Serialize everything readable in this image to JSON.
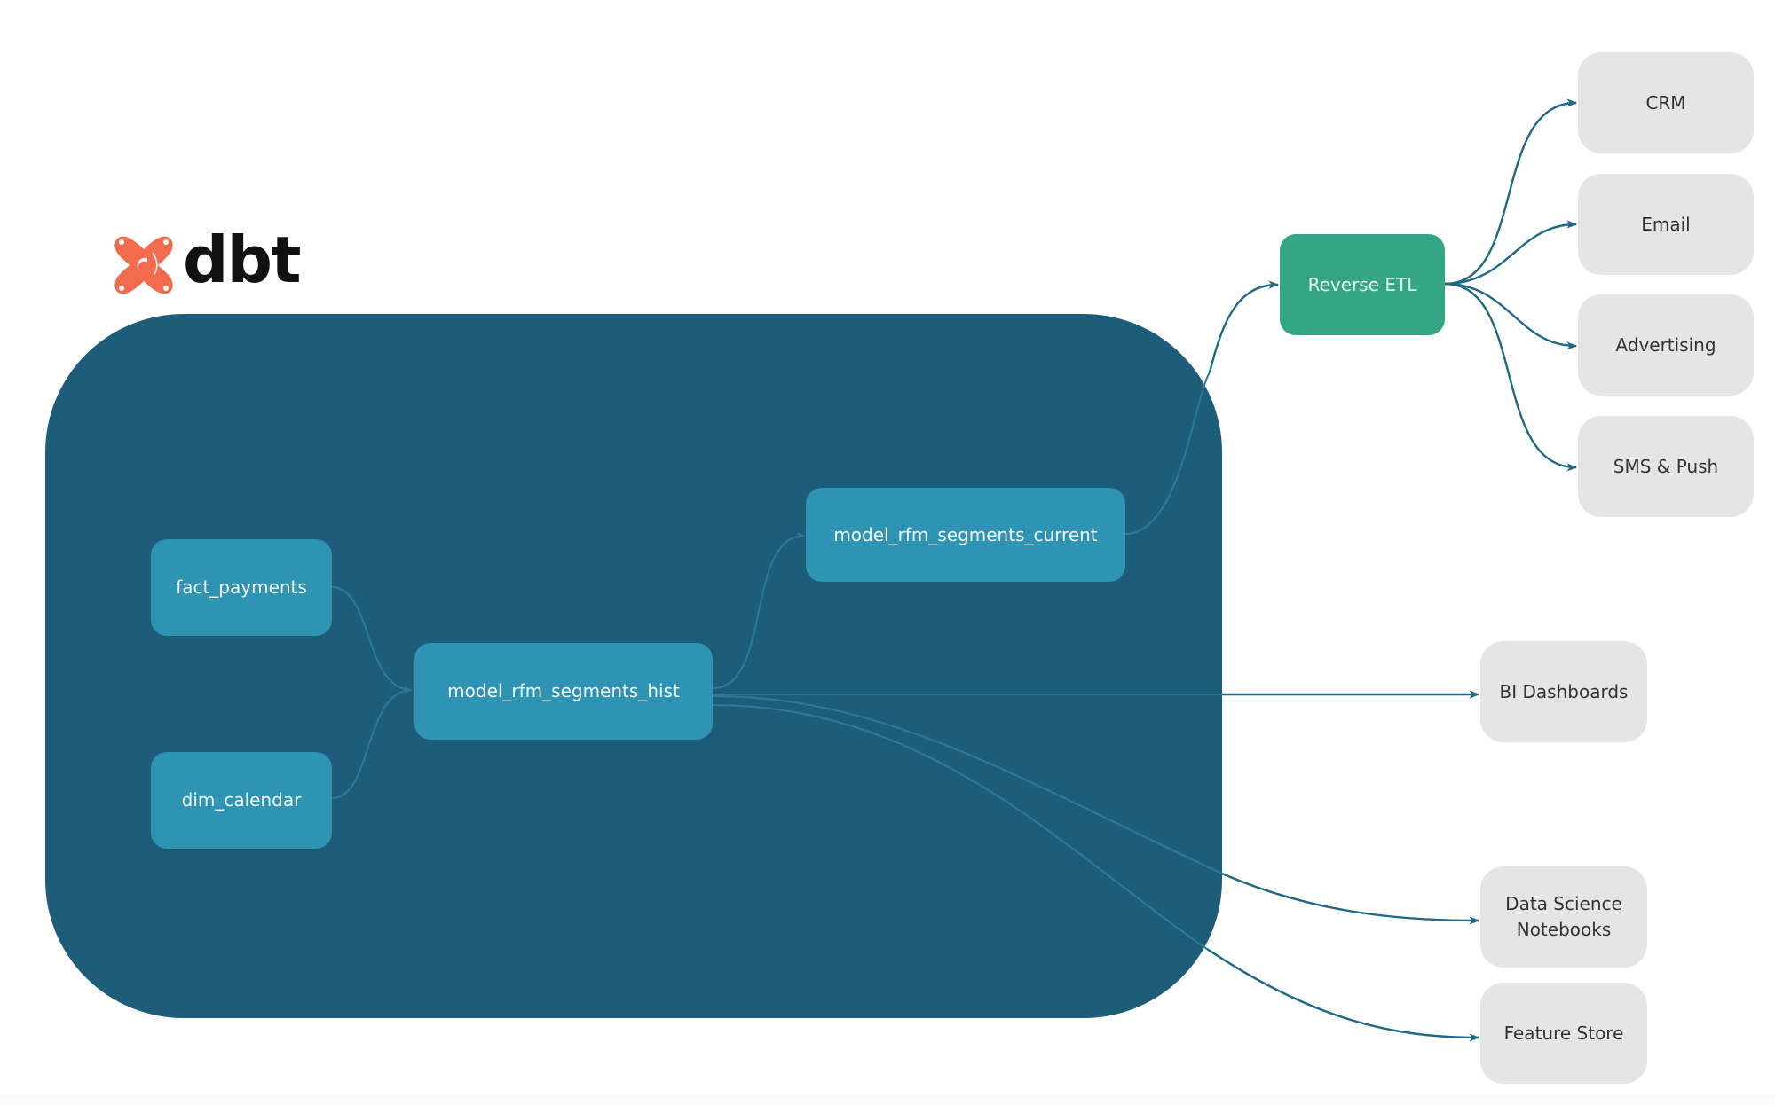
{
  "brand": {
    "name": "dbt",
    "logo_icon": "dbt-logo-icon",
    "logo_color": "#f26b4f"
  },
  "colors": {
    "container": "#1e5d7a",
    "model_node": "#2f94b3",
    "reverse_etl_node": "#34a585",
    "destination_node": "#e5e5e5",
    "edge": "#1f6886"
  },
  "nodes": {
    "fact_payments": {
      "label": "fact_payments",
      "kind": "dbt-model"
    },
    "dim_calendar": {
      "label": "dim_calendar",
      "kind": "dbt-model"
    },
    "model_rfm_segments_hist": {
      "label": "model_rfm_segments_hist",
      "kind": "dbt-model"
    },
    "model_rfm_segments_current": {
      "label": "model_rfm_segments_current",
      "kind": "dbt-model"
    },
    "reverse_etl": {
      "label": "Reverse ETL",
      "kind": "tool"
    },
    "crm": {
      "label": "CRM",
      "kind": "destination"
    },
    "email": {
      "label": "Email",
      "kind": "destination"
    },
    "advertising": {
      "label": "Advertising",
      "kind": "destination"
    },
    "sms_push": {
      "label": "SMS & Push",
      "kind": "destination"
    },
    "bi_dashboards": {
      "label": "BI Dashboards",
      "kind": "destination"
    },
    "data_science_notebooks": {
      "label": "Data Science\nNotebooks",
      "line1": "Data Science",
      "line2": "Notebooks",
      "kind": "destination"
    },
    "feature_store": {
      "label": "Feature Store",
      "kind": "destination"
    }
  },
  "edges": [
    {
      "from": "fact_payments",
      "to": "model_rfm_segments_hist"
    },
    {
      "from": "dim_calendar",
      "to": "model_rfm_segments_hist"
    },
    {
      "from": "model_rfm_segments_hist",
      "to": "model_rfm_segments_current"
    },
    {
      "from": "model_rfm_segments_current",
      "to": "reverse_etl"
    },
    {
      "from": "reverse_etl",
      "to": "crm"
    },
    {
      "from": "reverse_etl",
      "to": "email"
    },
    {
      "from": "reverse_etl",
      "to": "advertising"
    },
    {
      "from": "reverse_etl",
      "to": "sms_push"
    },
    {
      "from": "model_rfm_segments_hist",
      "to": "bi_dashboards"
    },
    {
      "from": "model_rfm_segments_hist",
      "to": "data_science_notebooks"
    },
    {
      "from": "model_rfm_segments_hist",
      "to": "feature_store"
    }
  ]
}
